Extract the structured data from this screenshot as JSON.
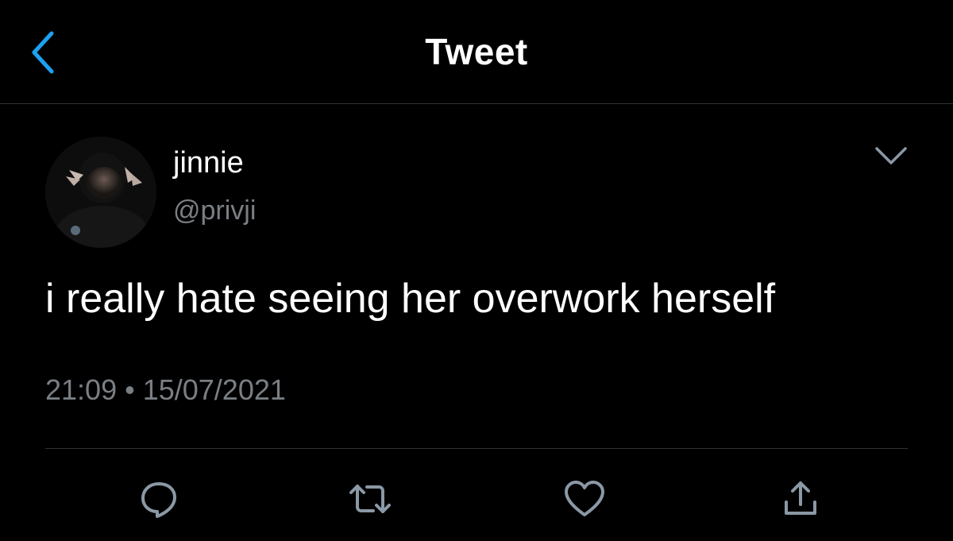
{
  "nav": {
    "title": "Tweet",
    "back_icon": "chevron-left-icon",
    "accent_color": "#1da1f2"
  },
  "tweet": {
    "author_name": "jinnie",
    "author_handle": "@privji",
    "text": "i really hate seeing her overwork herself",
    "time": "21:09",
    "separator": "•",
    "date": "15/07/2021",
    "more_icon": "chevron-down-icon"
  },
  "actions": [
    {
      "name": "reply",
      "icon": "comment-icon"
    },
    {
      "name": "retweet",
      "icon": "retweet-icon"
    },
    {
      "name": "like",
      "icon": "heart-icon"
    },
    {
      "name": "share",
      "icon": "share-icon"
    }
  ],
  "colors": {
    "background": "#000000",
    "text_primary": "#ffffff",
    "text_secondary": "#7a7f84",
    "divider": "#2f3336",
    "icon_gray": "#8b98a5"
  }
}
